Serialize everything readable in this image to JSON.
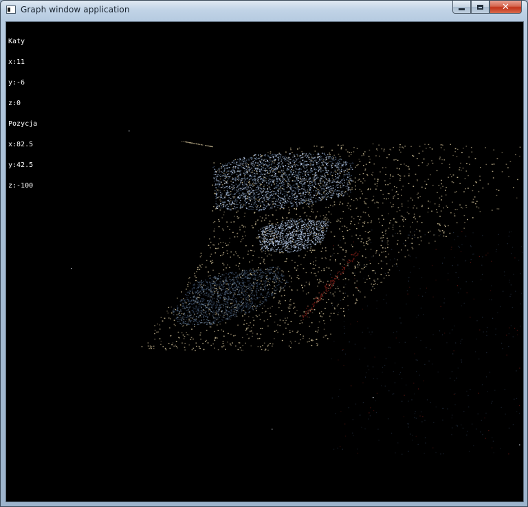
{
  "window": {
    "title": "Graph window application",
    "controls": {
      "minimize_label": "minimize",
      "maximize_label": "maximize",
      "close_label": "✕"
    }
  },
  "hud": {
    "angles_heading": "Katy",
    "angle_x": "x:11",
    "angle_y": "y:-6",
    "angle_z": "z:0",
    "position_heading": "Pozycja",
    "pos_x": "x:82.5",
    "pos_y": "y:42.5",
    "pos_z": "z:-100"
  },
  "scene": {
    "background_color": "#000000",
    "colors": {
      "sand": "#b8aa86",
      "sand_dark": "#7d7158",
      "gray_blue": "#6a7f96",
      "light_blue": "#b7c8e6",
      "dark_blue": "#2f3f56",
      "red": "#7a1d16"
    }
  }
}
